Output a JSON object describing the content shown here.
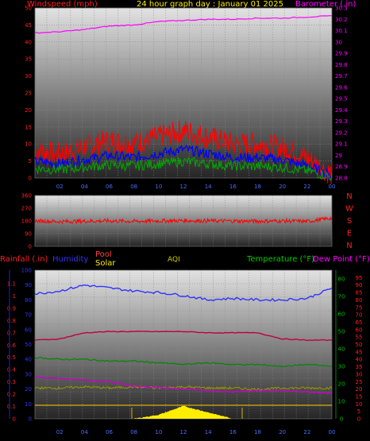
{
  "header": {
    "wind_label": "Windspeed (mph)",
    "title": "24 hour graph day : January 01 2025",
    "baro_label": "Barometer (.in)"
  },
  "panel3_header": {
    "rain_label": "Rainfall (.in)",
    "humidity_label": "Humidity",
    "pool_label": "Pool",
    "solar_label": "Solar",
    "aqi_label": "AQI",
    "temp_label": "Temperature (°F)",
    "dew_label": "Dew Point (°F)"
  },
  "compass": [
    "N",
    "W",
    "S",
    "E",
    "N"
  ],
  "x_ticks": [
    "02",
    "04",
    "06",
    "08",
    "10",
    "12",
    "14",
    "16",
    "18",
    "20",
    "22",
    "00"
  ],
  "colors": {
    "wind_gust": "#ff0000",
    "wind_avg": "#0000ff",
    "wind_low": "#00aa00",
    "barometer": "#ff00ff",
    "direction": "#ff0000",
    "humidity": "#3333ff",
    "pool": "#c00040",
    "solar": "#ffee00",
    "temperature": "#008800",
    "dewpoint": "#cc00cc",
    "aqi": "#999900"
  },
  "chart_data": [
    {
      "type": "line",
      "title": "24 hour graph day : January 01 2025",
      "x": [
        0,
        2,
        4,
        6,
        8,
        10,
        12,
        14,
        16,
        18,
        20,
        22,
        24
      ],
      "series": [
        {
          "name": "Windspeed (mph)",
          "values": [
            8,
            7,
            9,
            11,
            10,
            12,
            14,
            12,
            10,
            10,
            9,
            6,
            1
          ]
        },
        {
          "name": "Barometer (.in)",
          "values": [
            30.08,
            30.09,
            30.11,
            30.14,
            30.15,
            30.18,
            30.19,
            30.2,
            30.2,
            30.21,
            30.21,
            30.22,
            30.23
          ]
        }
      ],
      "left_axis": {
        "label": "Windspeed (mph)",
        "ticks": [
          "0",
          "5",
          "10",
          "15",
          "20",
          "25",
          "30",
          "35",
          "40",
          "45",
          "50"
        ],
        "ylim": [
          0,
          50
        ]
      },
      "right_axis": {
        "label": "Barometer (.in)",
        "ticks": [
          "28.8",
          "28.9",
          "29",
          "29.1",
          "29.2",
          "29.3",
          "29.4",
          "29.5",
          "29.6",
          "29.7",
          "29.8",
          "29.9",
          "30",
          "30.1",
          "30.2",
          "30.3"
        ],
        "ylim": [
          28.8,
          30.3
        ]
      }
    },
    {
      "type": "line",
      "x": [
        0,
        2,
        4,
        6,
        8,
        10,
        12,
        14,
        16,
        18,
        20,
        22,
        24
      ],
      "series": [
        {
          "values": [
            180,
            175,
            178,
            180,
            177,
            180,
            182,
            180,
            179,
            178,
            180,
            176,
            200
          ]
        }
      ],
      "left_axis": {
        "ticks": [
          "0",
          "90",
          "180",
          "270",
          "360"
        ],
        "ylim": [
          0,
          360
        ]
      }
    },
    {
      "type": "line",
      "x": [
        0,
        2,
        4,
        6,
        8,
        10,
        12,
        14,
        16,
        18,
        20,
        22,
        24
      ],
      "series": [
        {
          "name": "Humidity",
          "values": [
            84,
            86,
            90,
            88,
            86,
            85,
            83,
            80,
            81,
            80,
            80,
            81,
            88
          ]
        },
        {
          "name": "Pool",
          "values": [
            0.64,
            0.65,
            0.7,
            0.71,
            0.71,
            0.71,
            0.71,
            0.7,
            0.7,
            0.7,
            0.65,
            0.64,
            0.64
          ]
        },
        {
          "name": "Temperature (°F)",
          "values": [
            35,
            34,
            34,
            33,
            33,
            32,
            31,
            32,
            31,
            31,
            30,
            31,
            30
          ]
        },
        {
          "name": "Dew Point (°F)",
          "values": [
            28,
            27,
            26,
            25,
            22,
            21,
            20,
            19,
            18,
            19,
            19,
            18,
            17
          ]
        },
        {
          "name": "AQI",
          "values": [
            0.25,
            0.25,
            0.26,
            0.25,
            0.26,
            0.25,
            0.26,
            0.25,
            0.25,
            0.24,
            0.25,
            0.25,
            0.25
          ]
        },
        {
          "name": "Solar",
          "values": [
            0,
            0,
            0,
            0,
            0,
            25,
            80,
            40,
            0,
            0,
            0,
            0,
            0
          ]
        }
      ],
      "rain_axis": {
        "ticks": [
          "0",
          "0.1",
          "0.2",
          "0.3",
          "0.4",
          "0.5",
          "0.6",
          "0.7",
          "0.8",
          "0.9",
          "1",
          "1.1"
        ]
      },
      "humidity_axis": {
        "ticks": [
          "0",
          "10",
          "20",
          "30",
          "40",
          "50",
          "60",
          "70",
          "80",
          "90",
          "100"
        ]
      },
      "temp_axis": {
        "ticks": [
          "0",
          "10",
          "20",
          "30",
          "40",
          "50",
          "60",
          "70",
          "80"
        ]
      },
      "dew_axis": {
        "ticks": [
          "0",
          "5",
          "10",
          "15",
          "20",
          "25",
          "30",
          "35",
          "40",
          "45",
          "50",
          "55",
          "60",
          "65",
          "70",
          "75",
          "80",
          "85",
          "90",
          "95"
        ]
      }
    }
  ]
}
